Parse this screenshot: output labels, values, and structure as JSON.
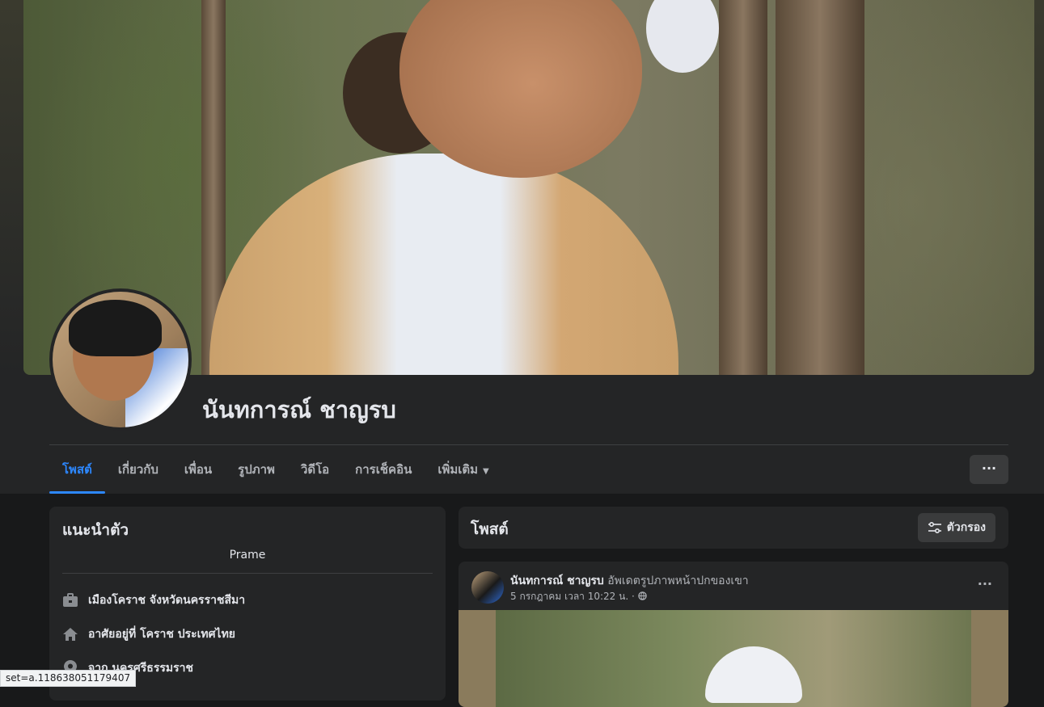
{
  "profile": {
    "name": "นันทการณ์ ชาญรบ"
  },
  "tabs": [
    {
      "label": "โพสต์",
      "active": true
    },
    {
      "label": "เกี่ยวกับ"
    },
    {
      "label": "เพื่อน"
    },
    {
      "label": "รูปภาพ"
    },
    {
      "label": "วิดีโอ"
    },
    {
      "label": "การเช็คอิน"
    },
    {
      "label": "เพิ่มเติม"
    }
  ],
  "more_button": "···",
  "intro": {
    "title": "แนะนำตัว",
    "bio": "Prame",
    "rows": [
      {
        "icon": "briefcase-icon",
        "text": "เมืองโคราช จังหวัดนครราชสีมา"
      },
      {
        "icon": "home-icon",
        "text": "อาศัยอยู่ที่ โคราช ประเทศไทย"
      },
      {
        "icon": "location-pin-icon",
        "text": "จาก นครศรีธรรมราช"
      }
    ]
  },
  "posts_section": {
    "title": "โพสต์",
    "filter_label": "ตัวกรอง"
  },
  "post": {
    "author": "นันทการณ์ ชาญรบ",
    "action": "อัพเดตรูปภาพหน้าปกของเขา",
    "timestamp": "5 กรกฎาคม เวลา 10:22 น.",
    "separator": "·",
    "dots": "···"
  },
  "status_bar": {
    "url": "set=a.118638051179407"
  },
  "colors": {
    "accent": "#2d88ff",
    "card": "#242526",
    "background": "#18191a"
  }
}
